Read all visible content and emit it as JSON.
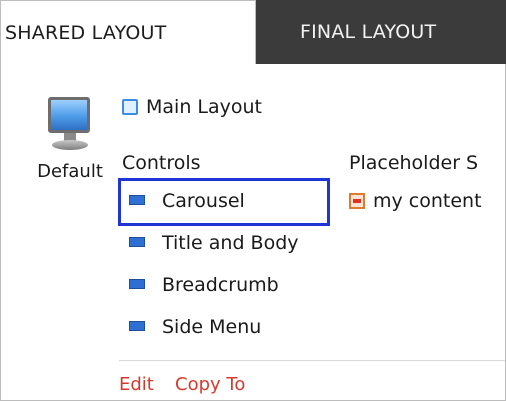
{
  "tabs": [
    {
      "label": "SHARED LAYOUT",
      "active": true
    },
    {
      "label": "FINAL LAYOUT",
      "active": false
    }
  ],
  "device": {
    "label": "Default",
    "icon": "monitor-icon"
  },
  "layout": {
    "label": "Main Layout",
    "icon": "page-icon"
  },
  "controls": {
    "heading": "Controls",
    "selected": "Carousel",
    "items": [
      {
        "label": "Carousel",
        "icon": "control-icon"
      },
      {
        "label": "Title and Body",
        "icon": "control-icon"
      },
      {
        "label": "Breadcrumb",
        "icon": "control-icon"
      },
      {
        "label": "Side Menu",
        "icon": "control-icon"
      }
    ]
  },
  "placeholders": {
    "heading": "Placeholder S",
    "items": [
      {
        "label": "my content",
        "icon": "placeholder-icon"
      }
    ]
  },
  "actions": {
    "edit": "Edit",
    "copy_to": "Copy To"
  },
  "colors": {
    "tab_dark": "#3b3b3b",
    "selection": "#1f35d6",
    "action_link": "#d63a2f",
    "control_icon": "#2e6fd1"
  }
}
